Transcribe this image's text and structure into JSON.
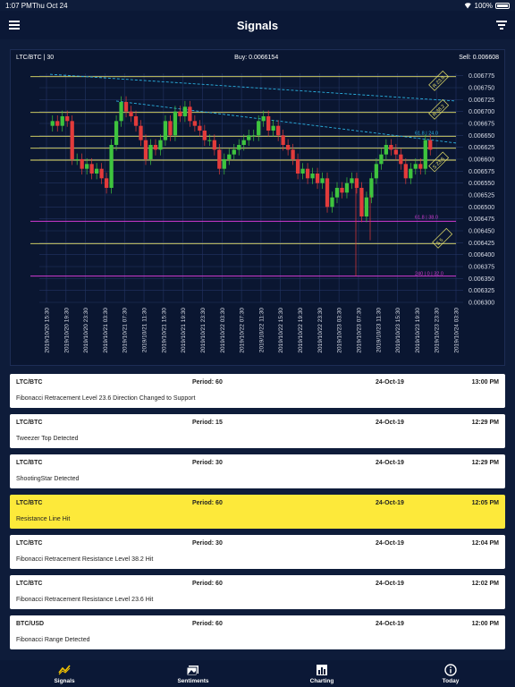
{
  "status_bar": {
    "time": "1:07 PM",
    "date": "Thu Oct 24",
    "battery": "100%"
  },
  "nav": {
    "title": "Signals"
  },
  "chart": {
    "pair_label": "LTC/BTC | 30",
    "buy_label": "Buy: 0.0066154",
    "sell_label": "Sell: 0.006608"
  },
  "chart_data": {
    "type": "candlestick",
    "title": "LTC/BTC | 30",
    "ylim": [
      0.0063,
      0.00678
    ],
    "yticks": [
      "0.006775",
      "0.006750",
      "0.006725",
      "0.006700",
      "0.006675",
      "0.006650",
      "0.006625",
      "0.006600",
      "0.006575",
      "0.006550",
      "0.006525",
      "0.006500",
      "0.006475",
      "0.006450",
      "0.006425",
      "0.006400",
      "0.006375",
      "0.006350",
      "0.006325",
      "0.006300"
    ],
    "xticks": [
      "2019/10/20 15:30",
      "2019/10/20 19:30",
      "2019/10/20 23:30",
      "2019/10/21 03:30",
      "2019/10/21 07:30",
      "2019/10/21 11:30",
      "2019/10/21 15:30",
      "2019/10/21 19:30",
      "2019/10/21 23:30",
      "2019/10/22 03:30",
      "2019/10/22 07:30",
      "2019/10/22 11:30",
      "2019/10/22 15:30",
      "2019/10/22 19:30",
      "2019/10/22 23:30",
      "2019/10/23 03:30",
      "2019/10/23 07:30",
      "2019/10/23 11:30",
      "2019/10/23 15:30",
      "2019/10/23 19:30",
      "2019/10/23 23:30",
      "2019/10/24 03:30"
    ],
    "level_labels": {
      "fib_1": "R 23.6",
      "fib_2": "R 38.2",
      "fib_3": "S 23.6",
      "fib_4": "S 5",
      "line_a": "61.8 | 24.0",
      "line_b": "61.8 | 38.0",
      "line_c": "240 | 0 | 32.0",
      "line_d": "23.6"
    },
    "closes": [
      0.00668,
      0.00667,
      0.00669,
      0.00668,
      0.0066,
      0.0066,
      0.00658,
      0.00659,
      0.00657,
      0.00658,
      0.00656,
      0.00654,
      0.00663,
      0.00668,
      0.00672,
      0.0067,
      0.00669,
      0.00667,
      0.00664,
      0.0066,
      0.00663,
      0.00662,
      0.00664,
      0.00668,
      0.00665,
      0.0067,
      0.00669,
      0.00671,
      0.00668,
      0.00667,
      0.00666,
      0.00664,
      0.00664,
      0.00662,
      0.00658,
      0.0066,
      0.00661,
      0.00662,
      0.00663,
      0.00664,
      0.00665,
      0.00665,
      0.00668,
      0.00669,
      0.00666,
      0.00667,
      0.00665,
      0.00663,
      0.00662,
      0.0066,
      0.00657,
      0.00658,
      0.00656,
      0.00657,
      0.00655,
      0.00656,
      0.0065,
      0.00652,
      0.00654,
      0.00653,
      0.00655,
      0.00656,
      0.00654,
      0.00648,
      0.00652,
      0.00656,
      0.00659,
      0.00661,
      0.00663,
      0.00662,
      0.00661,
      0.00659,
      0.00656,
      0.00658,
      0.00659,
      0.00658,
      0.00664,
      0.00662
    ]
  },
  "signals": [
    {
      "pair": "LTC/BTC",
      "period": "Period: 60",
      "date": "24-Oct-19",
      "time": "13:00 PM",
      "desc": "Fibonacci Retracement Level 23.6 Direction Changed to Support",
      "highlight": false
    },
    {
      "pair": "LTC/BTC",
      "period": "Period: 15",
      "date": "24-Oct-19",
      "time": "12:29 PM",
      "desc": "Tweezer Top Detected",
      "highlight": false
    },
    {
      "pair": "LTC/BTC",
      "period": "Period: 30",
      "date": "24-Oct-19",
      "time": "12:29 PM",
      "desc": "ShootingStar Detected",
      "highlight": false
    },
    {
      "pair": "LTC/BTC",
      "period": "Period: 60",
      "date": "24-Oct-19",
      "time": "12:05 PM",
      "desc": "Resistance Line Hit",
      "highlight": true
    },
    {
      "pair": "LTC/BTC",
      "period": "Period: 30",
      "date": "24-Oct-19",
      "time": "12:04 PM",
      "desc": "Fibonacci Retracement Resistance Level 38.2 Hit",
      "highlight": false
    },
    {
      "pair": "LTC/BTC",
      "period": "Period: 60",
      "date": "24-Oct-19",
      "time": "12:02 PM",
      "desc": "Fibonacci Retracement Resistance Level 23.6 Hit",
      "highlight": false
    },
    {
      "pair": "BTC/USD",
      "period": "Period: 60",
      "date": "24-Oct-19",
      "time": "12:00 PM",
      "desc": "Fibonacci Range Detected",
      "highlight": false
    }
  ],
  "tabs": [
    {
      "label": "Signals",
      "icon": "trend-icon"
    },
    {
      "label": "Sentiments",
      "icon": "images-icon"
    },
    {
      "label": "Charting",
      "icon": "bar-chart-icon"
    },
    {
      "label": "Today",
      "icon": "info-icon"
    }
  ],
  "colors": {
    "background": "#0e1c3a",
    "highlight": "#fde93a",
    "up": "#3ec43e",
    "down": "#e23b3b",
    "trend": "#2bb1e0",
    "fib": "#e8e36a",
    "magenta": "#d23ad2"
  }
}
